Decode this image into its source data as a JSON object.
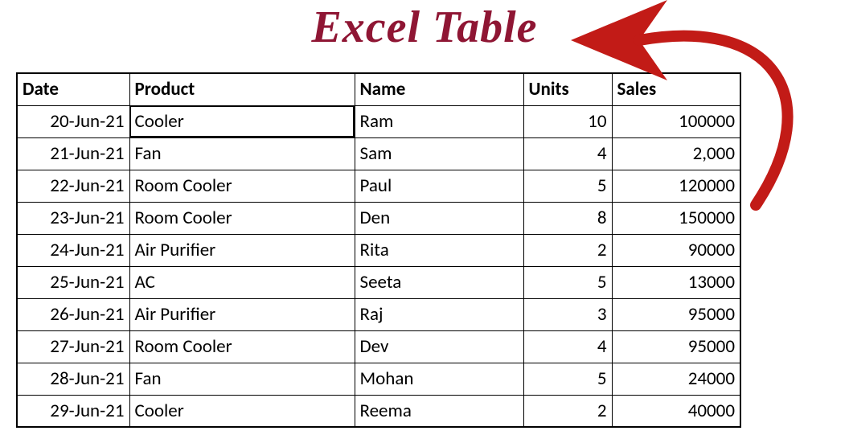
{
  "title": "Excel Table",
  "columns": [
    "Date",
    "Product",
    "Name",
    "Units",
    "Sales"
  ],
  "rows": [
    {
      "date": "20-Jun-21",
      "product": "Cooler",
      "name": "Ram",
      "units": "10",
      "sales": "100000"
    },
    {
      "date": "21-Jun-21",
      "product": "Fan",
      "name": "Sam",
      "units": "4",
      "sales": "2,000"
    },
    {
      "date": "22-Jun-21",
      "product": "Room Cooler",
      "name": "Paul",
      "units": "5",
      "sales": "120000"
    },
    {
      "date": "23-Jun-21",
      "product": "Room Cooler",
      "name": "Den",
      "units": "8",
      "sales": "150000"
    },
    {
      "date": "24-Jun-21",
      "product": "Air Purifier",
      "name": "Rita",
      "units": "2",
      "sales": "90000"
    },
    {
      "date": "25-Jun-21",
      "product": "AC",
      "name": "Seeta",
      "units": "5",
      "sales": "13000"
    },
    {
      "date": "26-Jun-21",
      "product": "Air Purifier",
      "name": "Raj",
      "units": "3",
      "sales": "95000"
    },
    {
      "date": "27-Jun-21",
      "product": "Room Cooler",
      "name": "Dev",
      "units": "4",
      "sales": "95000"
    },
    {
      "date": "28-Jun-21",
      "product": "Fan",
      "name": "Mohan",
      "units": "5",
      "sales": "24000"
    },
    {
      "date": "29-Jun-21",
      "product": "Cooler",
      "name": "Reema",
      "units": "2",
      "sales": "40000"
    }
  ],
  "selected_cell": {
    "row": 0,
    "col": "product"
  },
  "chart_data": {
    "type": "table",
    "title": "Excel Table",
    "columns": [
      "Date",
      "Product",
      "Name",
      "Units",
      "Sales"
    ],
    "rows": [
      [
        "20-Jun-21",
        "Cooler",
        "Ram",
        10,
        100000
      ],
      [
        "21-Jun-21",
        "Fan",
        "Sam",
        4,
        2000
      ],
      [
        "22-Jun-21",
        "Room Cooler",
        "Paul",
        5,
        120000
      ],
      [
        "23-Jun-21",
        "Room Cooler",
        "Den",
        8,
        150000
      ],
      [
        "24-Jun-21",
        "Air Purifier",
        "Rita",
        2,
        90000
      ],
      [
        "25-Jun-21",
        "AC",
        "Seeta",
        5,
        13000
      ],
      [
        "26-Jun-21",
        "Air Purifier",
        "Raj",
        3,
        95000
      ],
      [
        "27-Jun-21",
        "Room Cooler",
        "Dev",
        4,
        95000
      ],
      [
        "28-Jun-21",
        "Fan",
        "Mohan",
        5,
        24000
      ],
      [
        "29-Jun-21",
        "Cooler",
        "Reema",
        2,
        40000
      ]
    ]
  }
}
